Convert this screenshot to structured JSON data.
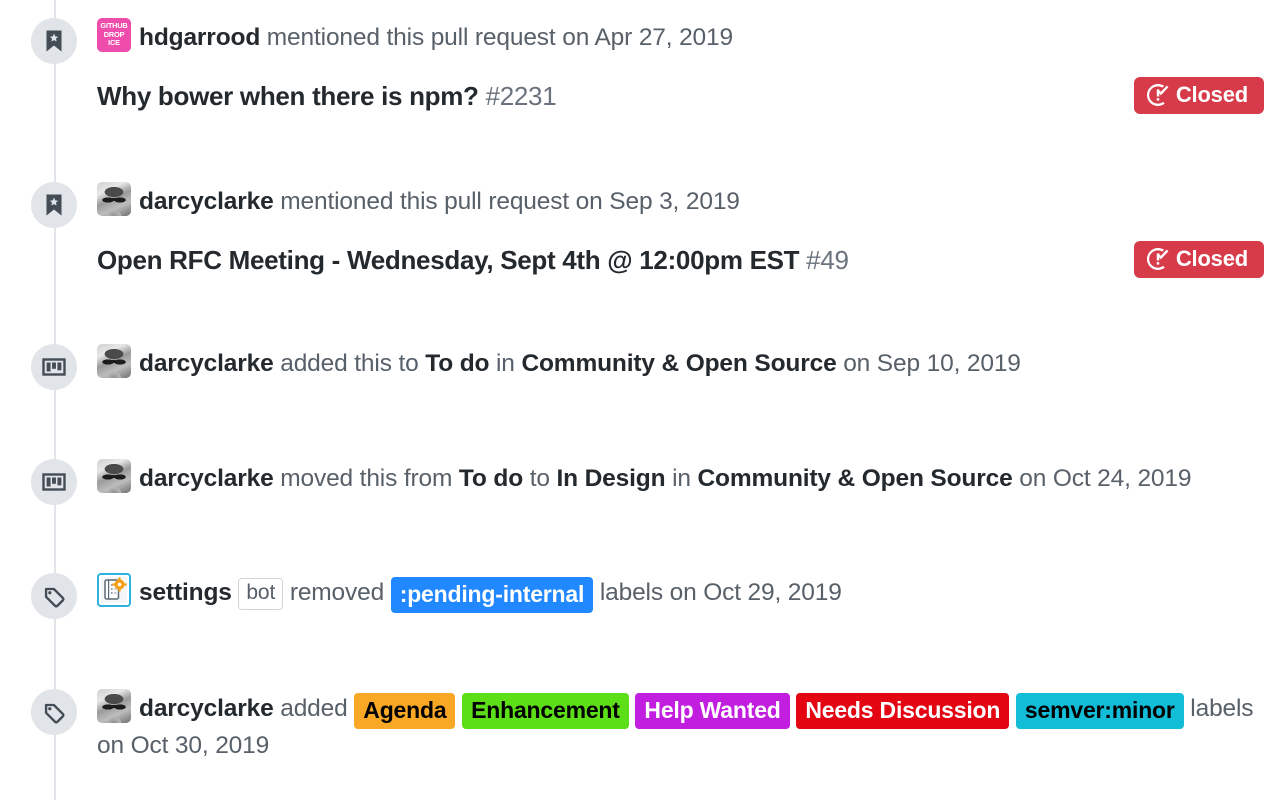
{
  "theme": {
    "rail_color": "#e1e4e8",
    "badge_bg": "#e1e4e8",
    "icon_color": "#444d56",
    "text_muted": "#586069",
    "text_strong": "#24292e",
    "closed_bg": "#d73a49"
  },
  "events": [
    {
      "id": "mention-2231",
      "icon": "bookmark-icon",
      "avatar": {
        "type": "dropice",
        "alt": "hdgarrood",
        "text": "GITHUB DROP ICE",
        "color": "#ef4dab"
      },
      "actor": "hdgarrood",
      "action": " mentioned this pull request on ",
      "date": "Apr 27, 2019",
      "reference": {
        "title": "Why bower when there is npm?",
        "number": "#2231",
        "state": "Closed",
        "state_icon": "issue-closed-icon",
        "state_color": "#d73a49"
      }
    },
    {
      "id": "mention-49",
      "icon": "bookmark-icon",
      "avatar": {
        "type": "photo",
        "alt": "darcyclarke"
      },
      "actor": "darcyclarke",
      "action": " mentioned this pull request on ",
      "date": "Sep 3, 2019",
      "reference": {
        "title": "Open RFC Meeting - Wednesday, Sept 4th @ 12:00pm EST",
        "number": "#49",
        "state": "Closed",
        "state_icon": "issue-closed-icon",
        "state_color": "#d73a49"
      }
    },
    {
      "id": "project-added",
      "icon": "project-board-icon",
      "avatar": {
        "type": "photo",
        "alt": "darcyclarke"
      },
      "actor": "darcyclarke",
      "segments": [
        {
          "text": " added this to ",
          "style": "muted"
        },
        {
          "text": "To do",
          "style": "strong"
        },
        {
          "text": " in ",
          "style": "muted"
        },
        {
          "text": "Community & Open Source",
          "style": "strong"
        },
        {
          "text": " on Sep 10, 2019",
          "style": "muted"
        }
      ]
    },
    {
      "id": "project-moved",
      "icon": "project-board-icon",
      "avatar": {
        "type": "photo",
        "alt": "darcyclarke"
      },
      "actor": "darcyclarke",
      "segments": [
        {
          "text": " moved this from ",
          "style": "muted"
        },
        {
          "text": "To do",
          "style": "strong"
        },
        {
          "text": " to ",
          "style": "muted"
        },
        {
          "text": "In Design",
          "style": "strong"
        },
        {
          "text": " in ",
          "style": "muted"
        },
        {
          "text": "Community & Open Source",
          "style": "strong"
        },
        {
          "text": " on Oct 24, 2019",
          "style": "muted"
        }
      ]
    },
    {
      "id": "labels-removed",
      "icon": "tag-icon",
      "avatar": {
        "type": "bot",
        "alt": "settings"
      },
      "actor": "settings",
      "bot_badge": "bot",
      "action_before": " removed ",
      "labels": [
        {
          "name": ":pending-internal",
          "bg": "#2188ff",
          "fg": "#ffffff"
        }
      ],
      "action_after": " labels on ",
      "date": "Oct 29, 2019"
    },
    {
      "id": "labels-added",
      "icon": "tag-icon",
      "avatar": {
        "type": "photo",
        "alt": "darcyclarke"
      },
      "actor": "darcyclarke",
      "action_before": " added ",
      "labels": [
        {
          "name": "Agenda",
          "bg": "#f9a825",
          "fg": "#000000"
        },
        {
          "name": "Enhancement",
          "bg": "#5ddf18",
          "fg": "#000000"
        },
        {
          "name": "Help Wanted",
          "bg": "#c21ee0",
          "fg": "#ffffff"
        },
        {
          "name": "Needs Discussion",
          "bg": "#e30512",
          "fg": "#ffffff"
        },
        {
          "name": "semver:minor",
          "bg": "#12bdd8",
          "fg": "#000000"
        }
      ],
      "action_after": " labels",
      "date_line": "on Oct 30, 2019"
    }
  ]
}
